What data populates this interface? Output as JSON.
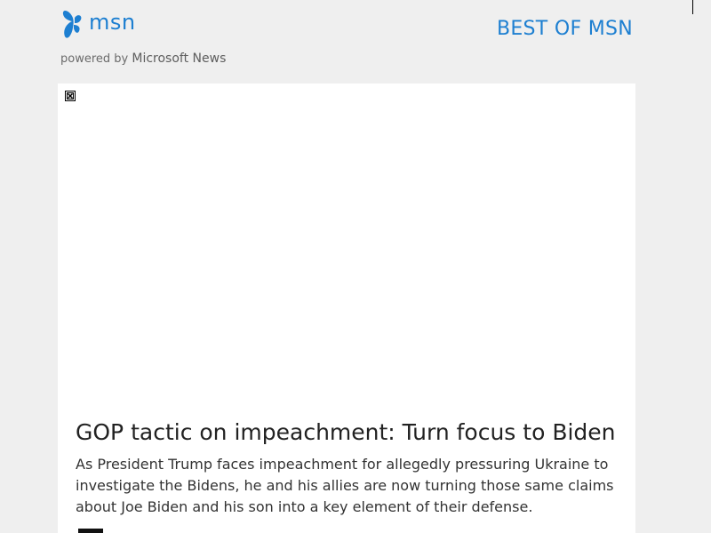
{
  "header": {
    "logo_text": "msn",
    "powered_by_prefix": "powered by",
    "powered_by_brand": "Microsoft News",
    "nav_link": "BEST OF MSN",
    "brand_color": "#1d7fd1"
  },
  "article": {
    "headline": "GOP tactic on impeachment: Turn focus to Biden",
    "summary": "As President Trump faces impeachment for allegedly pressuring Ukraine to investigate the Bidens, he and his allies are now turning those same claims about Joe Biden and his son into a key element of their defense.",
    "image_icon": "broken-image-icon"
  }
}
